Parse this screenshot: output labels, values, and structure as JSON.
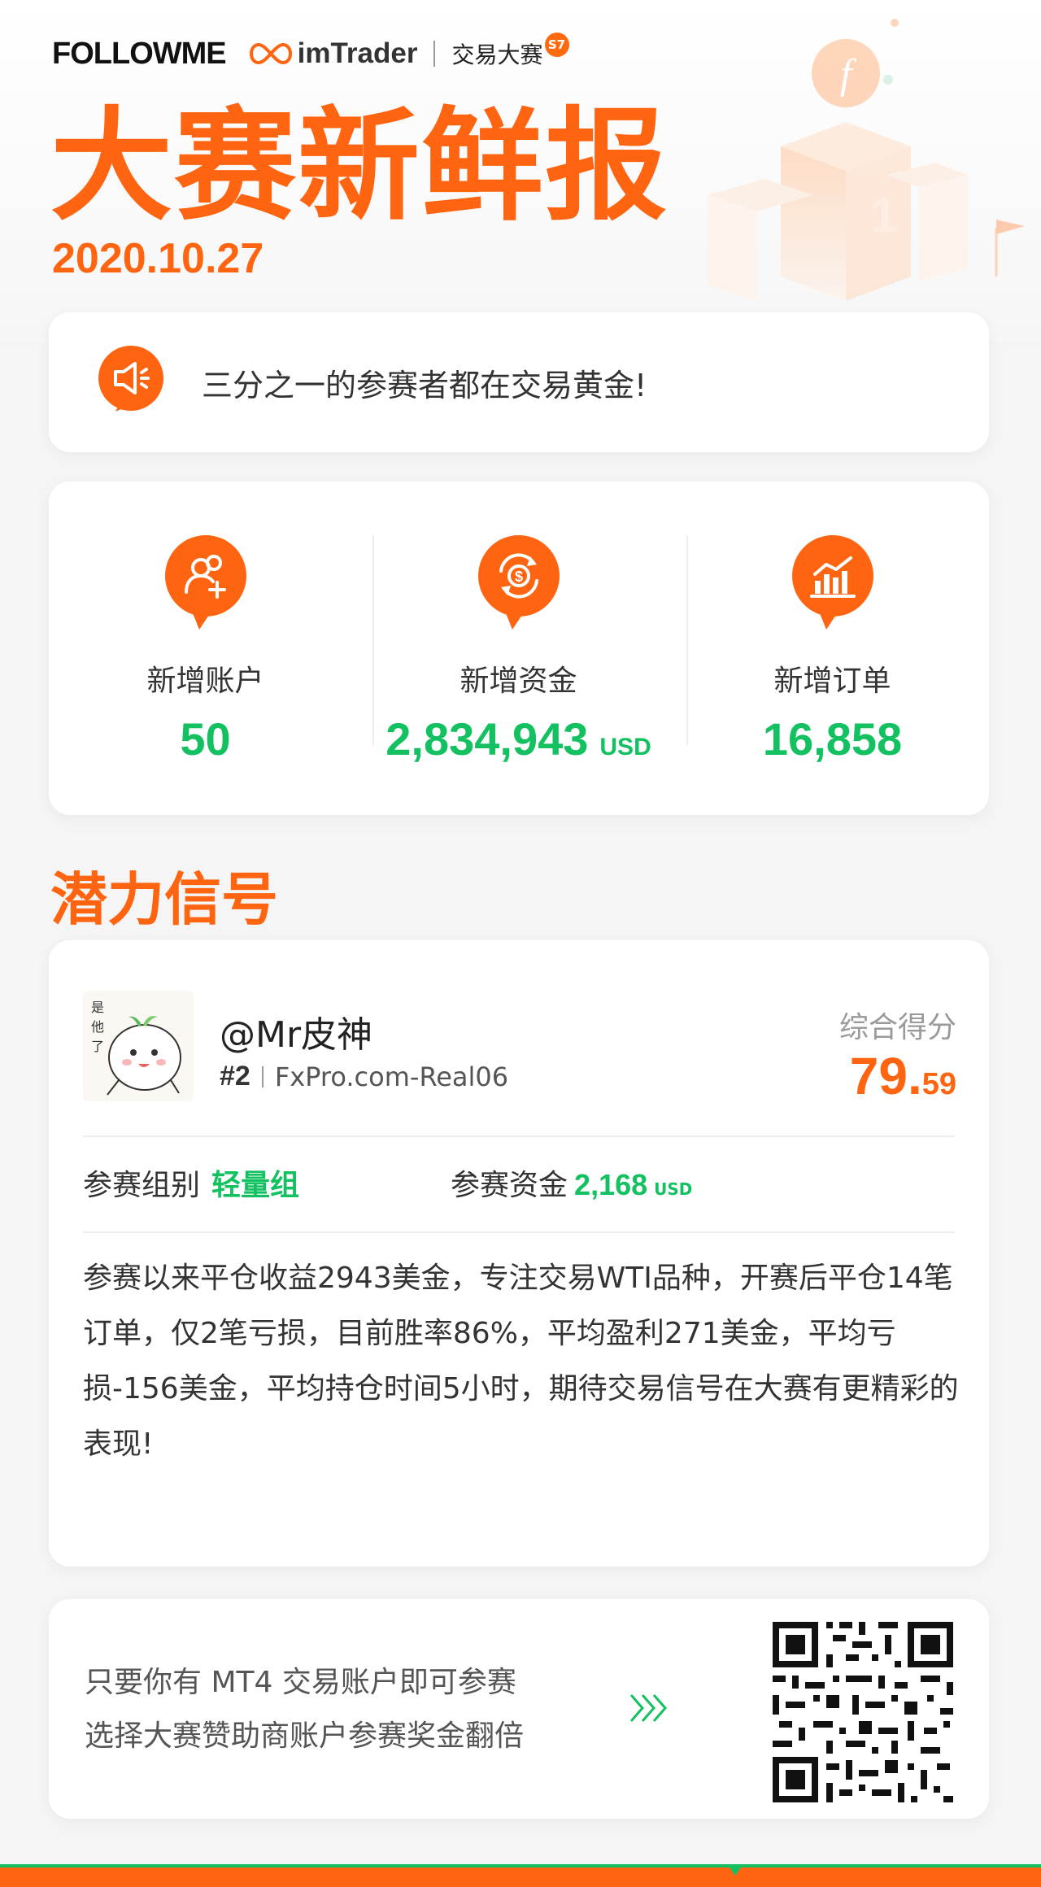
{
  "header": {
    "brand": "FOLLOWME",
    "partner": "imTrader",
    "event": "交易大赛",
    "season_badge": "S7"
  },
  "hero": {
    "title": "大赛新鲜报",
    "date": "2020.10.27"
  },
  "notice": {
    "icon": "speaker-icon",
    "text": "三分之一的参赛者都在交易黄金!"
  },
  "stats": [
    {
      "icon": "add-user-icon",
      "label": "新增账户",
      "value": "50",
      "unit": ""
    },
    {
      "icon": "money-cycle-icon",
      "label": "新增资金",
      "value": "2,834,943",
      "unit": "USD"
    },
    {
      "icon": "bar-chart-icon",
      "label": "新增订单",
      "value": "16,858",
      "unit": ""
    }
  ],
  "signal_section": {
    "title": "潜力信号",
    "name": "@Mr皮神",
    "rank": "#2",
    "account": "FxPro.com-Real06",
    "score_label": "综合得分",
    "score_int": "79.",
    "score_dec": "59",
    "group_label": "参赛组别",
    "group_value": "轻量组",
    "capital_label": "参赛资金",
    "capital_value": "2,168",
    "capital_unit": "USD",
    "description": "参赛以来平仓收益2943美金，专注交易WTI品种，开赛后平仓14笔订单，仅2笔亏损，目前胜率86%，平均盈利271美金，平均亏损-156美金，平均持仓时间5小时，期待交易信号在大赛有更精彩的表现!"
  },
  "cta": {
    "line1": "只要你有 MT4 交易账户即可参赛",
    "line2": "选择大赛赞助商账户参赛奖金翻倍"
  },
  "colors": {
    "accent": "#ff6410",
    "green": "#13c161",
    "card": "#ffffff",
    "background": "#f5f5f5"
  }
}
